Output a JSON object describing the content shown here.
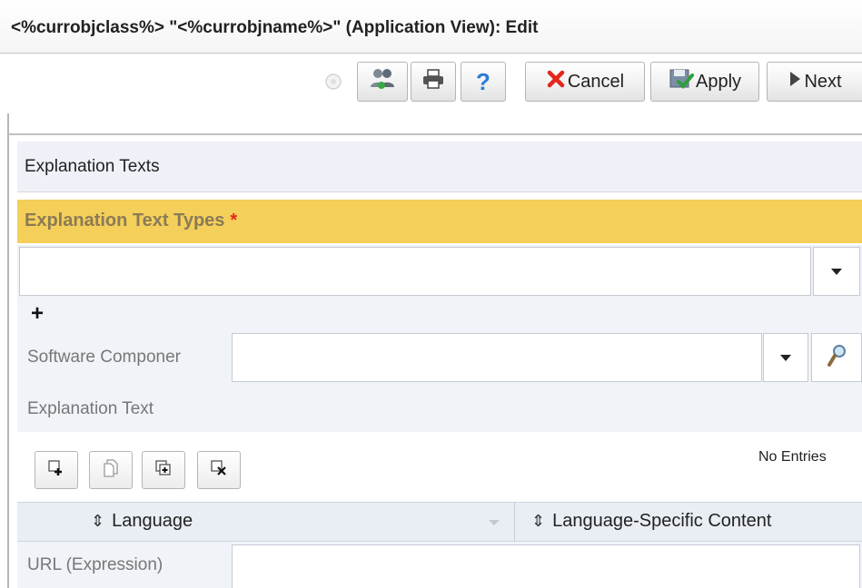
{
  "window": {
    "title": "<%currobjclass%> \"<%currobjname%>\" (Application View): Edit"
  },
  "toolbar": {
    "cancel_label": "Cancel",
    "apply_label": "Apply",
    "next_label": "Next",
    "help_label": "?"
  },
  "section": {
    "title": "Explanation Texts"
  },
  "explanation_text_types": {
    "title": "Explanation Text Types",
    "required_marker": "*",
    "value": ""
  },
  "software_component": {
    "label": "Software Componer",
    "value": ""
  },
  "explanation_text": {
    "label": "Explanation Text",
    "empty_text": "No Entries",
    "columns": [
      "Language",
      "Language-Specific Content"
    ]
  },
  "url_expression": {
    "label": "URL (Expression)",
    "value": ""
  },
  "colors": {
    "group_header": "#f4cf5a",
    "required": "#e4261c",
    "panel": "#eef1f7",
    "cancel_icon": "#e4261c",
    "help_icon": "#2b7bd6"
  }
}
